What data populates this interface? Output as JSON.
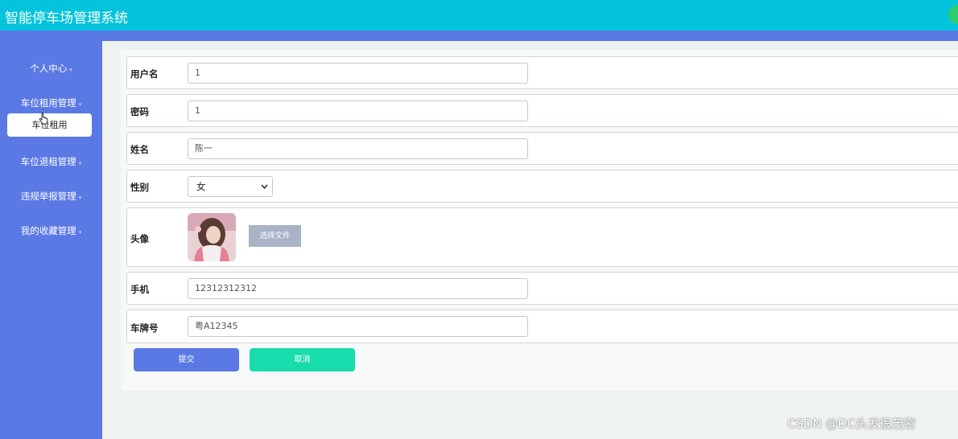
{
  "app": {
    "title": "智能停车场管理系统"
  },
  "sidebar": {
    "items": [
      {
        "label": "个人中心"
      },
      {
        "label": "车位租用管理"
      },
      {
        "label": "车位退租管理"
      },
      {
        "label": "违规举报管理"
      },
      {
        "label": "我的收藏管理"
      }
    ],
    "active_sub": "车位租用",
    "caret_glyph": "▾"
  },
  "form": {
    "username": {
      "label": "用户名",
      "value": "1"
    },
    "password": {
      "label": "密码",
      "value": "1"
    },
    "name": {
      "label": "姓名",
      "value": "陈一"
    },
    "gender": {
      "label": "性别",
      "value": "女"
    },
    "avatar": {
      "label": "头像",
      "file_button": "选择文件"
    },
    "phone": {
      "label": "手机",
      "value": "12312312312"
    },
    "plate": {
      "label": "车牌号",
      "value": "粤A12345"
    }
  },
  "actions": {
    "submit": "提交",
    "cancel": "取消"
  },
  "watermark": "CSDN @DC头发很茂密",
  "colors": {
    "topbar": "#03c4dc",
    "sidebar": "#5b79e4",
    "submit": "#5b79e4",
    "cancel": "#17ddac"
  }
}
